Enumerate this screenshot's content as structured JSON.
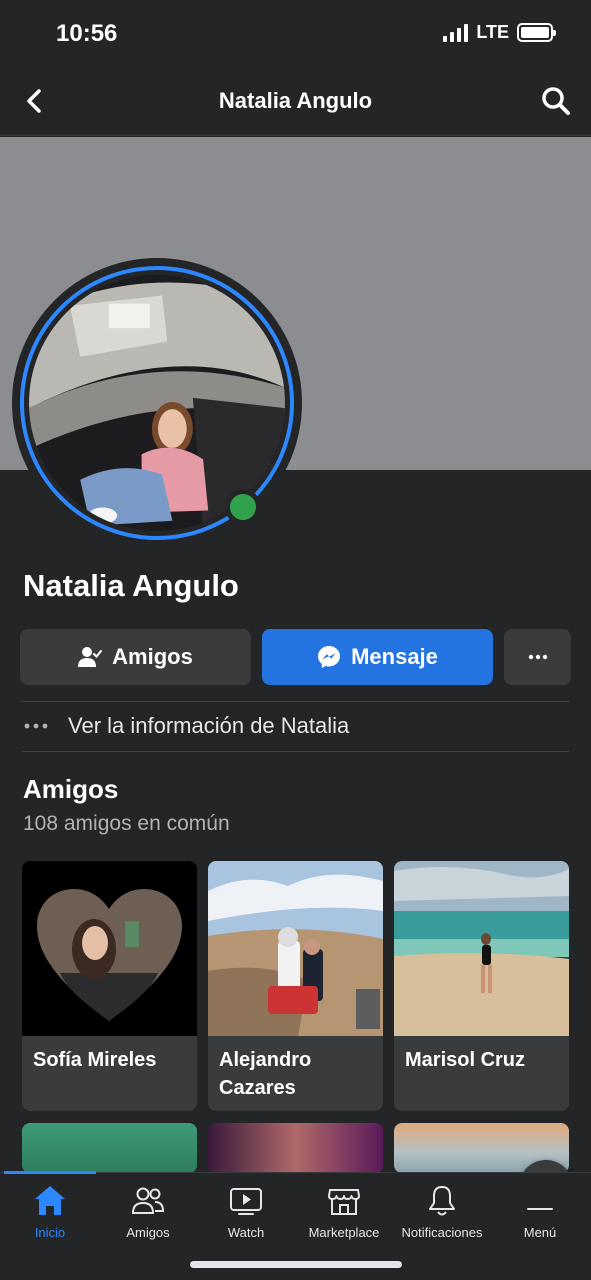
{
  "status_bar": {
    "time": "10:56",
    "network": "LTE"
  },
  "header": {
    "title": "Natalia Angulo"
  },
  "profile": {
    "name": "Natalia Angulo",
    "online": true
  },
  "actions": {
    "friends_label": "Amigos",
    "message_label": "Mensaje"
  },
  "info_link": {
    "label": "Ver la información de Natalia"
  },
  "friends_section": {
    "title": "Amigos",
    "subtitle": "108 amigos en común",
    "items": [
      {
        "name": "Sofía Mireles"
      },
      {
        "name": "Alejandro Cazares"
      },
      {
        "name": "Marisol Cruz"
      }
    ]
  },
  "bottom_nav": {
    "tabs": [
      {
        "label": "Inicio",
        "icon": "home-icon",
        "active": true
      },
      {
        "label": "Amigos",
        "icon": "friends-icon"
      },
      {
        "label": "Watch",
        "icon": "watch-icon"
      },
      {
        "label": "Marketplace",
        "icon": "marketplace-icon"
      },
      {
        "label": "Notificaciones",
        "icon": "bell-icon"
      },
      {
        "label": "Menú",
        "icon": "menu-icon"
      }
    ]
  },
  "colors": {
    "background": "#242526",
    "accent": "#2d88ff",
    "message_button": "#2374e1",
    "online": "#31a24c",
    "cover": "#8b8d91"
  }
}
